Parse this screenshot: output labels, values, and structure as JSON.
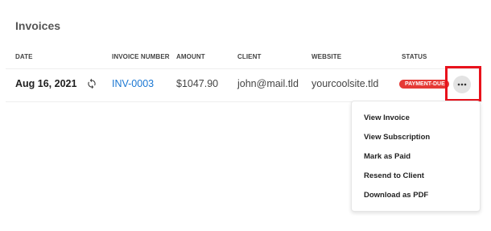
{
  "page": {
    "title": "Invoices"
  },
  "table": {
    "columns": [
      "DATE",
      "INVOICE NUMBER",
      "AMOUNT",
      "CLIENT",
      "WEBSITE",
      "STATUS"
    ],
    "rows": [
      {
        "date": "Aug 16, 2021",
        "invoice_number": "INV-0003",
        "amount": "$1047.90",
        "client": "john@mail.tld",
        "website": "yourcoolsite.tld",
        "status": "PAYMENT-DUE"
      }
    ]
  },
  "menu": {
    "items": [
      "View Invoice",
      "View Subscription",
      "Mark as Paid",
      "Resend to Client",
      "Download as PDF"
    ]
  },
  "colors": {
    "accent_link": "#1976d2",
    "status_due": "#e53935",
    "highlight": "#e8121c"
  },
  "icons": {
    "refresh": "refresh-icon",
    "more": "more-horizontal-icon"
  }
}
